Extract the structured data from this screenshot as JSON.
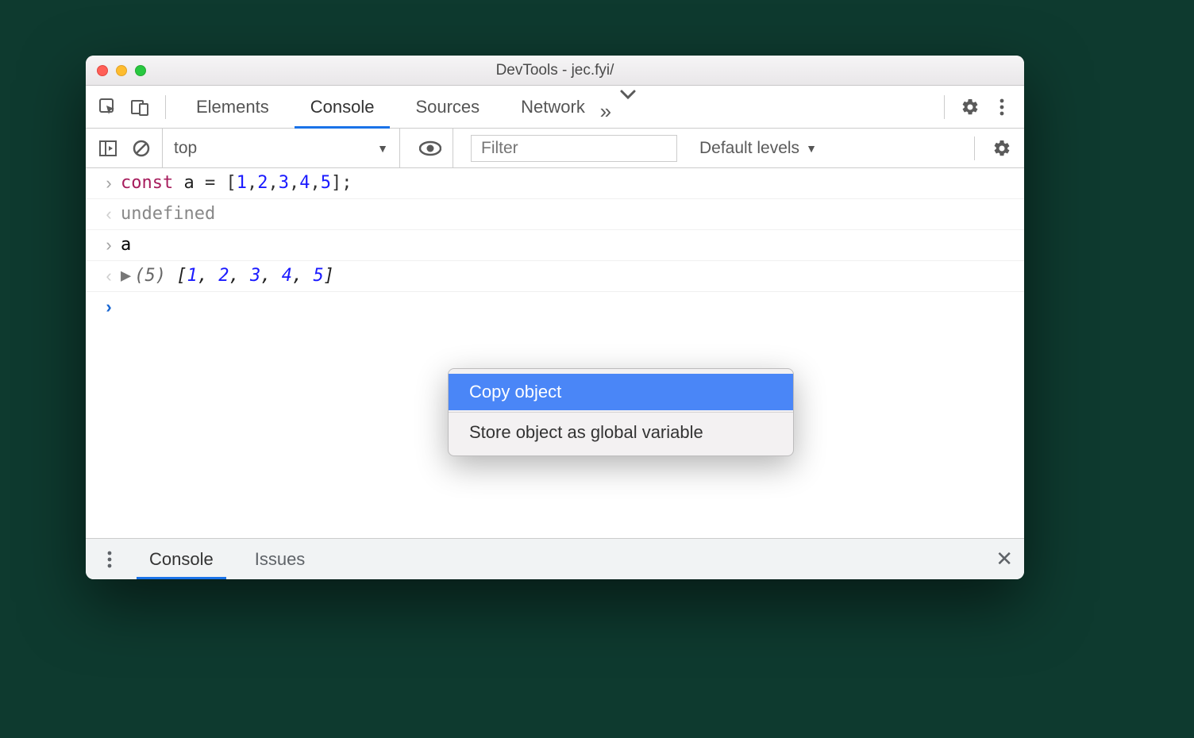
{
  "window": {
    "title": "DevTools - jec.fyi/"
  },
  "tabs": {
    "elements": "Elements",
    "console": "Console",
    "sources": "Sources",
    "network": "Network"
  },
  "toolbar": {
    "context": "top",
    "filter_placeholder": "Filter",
    "levels": "Default levels"
  },
  "console": {
    "line1_kw": "const",
    "line1_var": " a ",
    "line1_eq": "= [",
    "line1_nums": [
      "1",
      "2",
      "3",
      "4",
      "5"
    ],
    "line1_end": "];",
    "line2": "undefined",
    "line3": "a",
    "line4_len": "(5)",
    "line4_open": " [",
    "line4_nums": [
      "1",
      "2",
      "3",
      "4",
      "5"
    ],
    "line4_close": "]"
  },
  "context_menu": {
    "copy": "Copy object",
    "store": "Store object as global variable"
  },
  "drawer": {
    "console": "Console",
    "issues": "Issues"
  }
}
